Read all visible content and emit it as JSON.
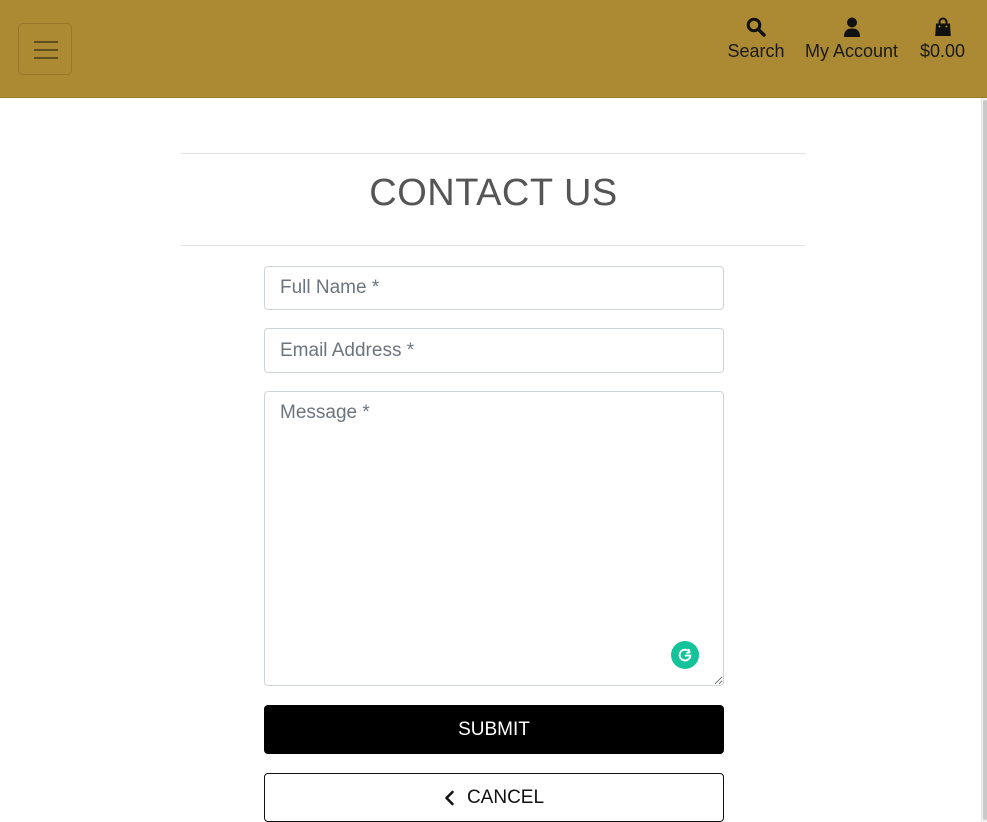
{
  "header": {
    "menu_icon": "hamburger-icon",
    "nav": {
      "search": {
        "icon": "search-icon",
        "label": "Search"
      },
      "account": {
        "icon": "user-icon",
        "label": "My Account"
      },
      "bag": {
        "icon": "shopping-bag-icon",
        "label": "$0.00"
      }
    },
    "bar_color": "#ab8a33"
  },
  "page": {
    "title": "CONTACT US"
  },
  "form": {
    "full_name": {
      "value": "",
      "placeholder": "Full Name *"
    },
    "email": {
      "value": "",
      "placeholder": "Email Address *"
    },
    "message": {
      "value": "",
      "placeholder": "Message *"
    },
    "grammarly_icon": "grammarly-icon",
    "submit_label": "SUBMIT",
    "cancel_label": "CANCEL",
    "cancel_icon": "chevron-left-icon"
  }
}
